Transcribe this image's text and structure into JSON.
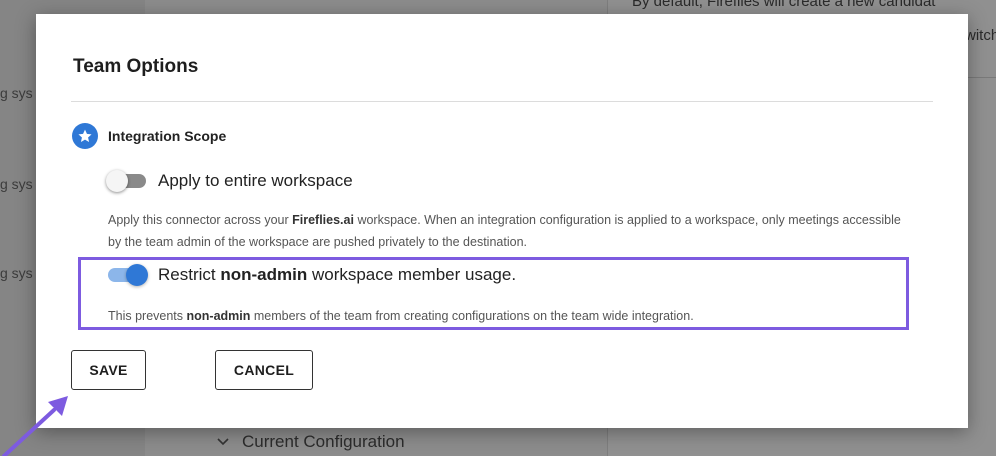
{
  "background": {
    "left_items": [
      "g sys",
      "g sys",
      "g sys"
    ],
    "right_text_line1": "By default, Fireflies will create a new candidat",
    "right_text_line2": "witch",
    "config_label": "Current Configuration"
  },
  "modal": {
    "title": "Team Options",
    "scope_label": "Integration Scope",
    "option1": {
      "label": "Apply to entire workspace",
      "enabled": false,
      "desc_pre": "Apply this connector across your ",
      "desc_bold": "Fireflies.ai",
      "desc_post": " workspace. When an integration configuration is applied to a workspace, only meetings accessible by the team admin of the workspace are pushed privately to the destination."
    },
    "option2": {
      "label_pre": "Restrict ",
      "label_bold": "non-admin",
      "label_post": " workspace member usage.",
      "enabled": true,
      "desc_pre": "This prevents ",
      "desc_bold": "non-admin",
      "desc_post": " members of the team from creating configurations on the team wide integration."
    },
    "save_label": "SAVE",
    "cancel_label": "CANCEL"
  },
  "colors": {
    "accent": "#2f78d6",
    "highlight": "#7d5be0"
  },
  "icons": [
    "star-icon",
    "chevron-down-icon",
    "arrow-icon"
  ]
}
